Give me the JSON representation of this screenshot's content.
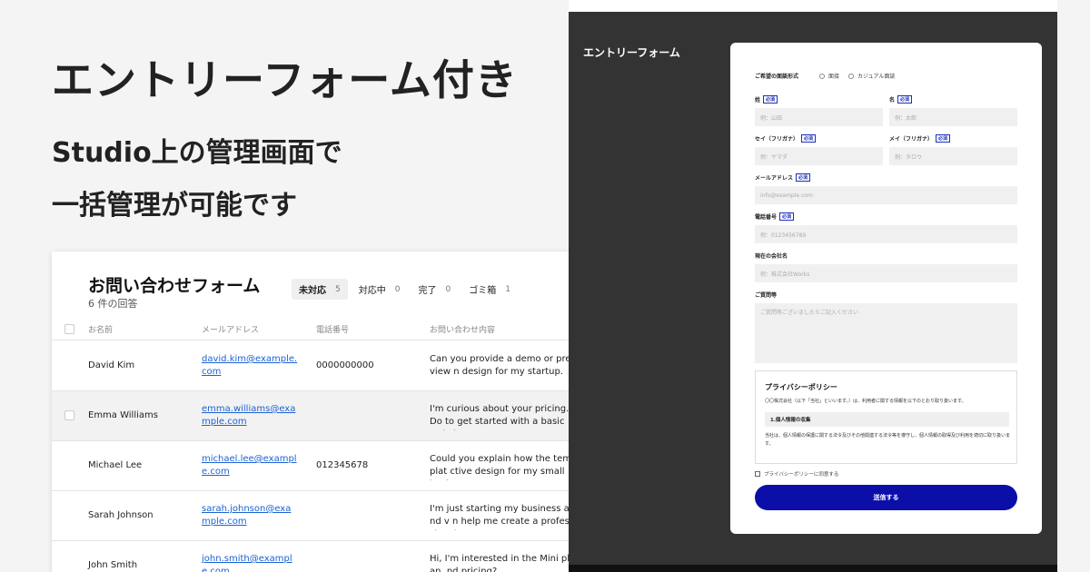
{
  "hero": {
    "title": "エントリーフォーム付き",
    "subtitle_line1": "Studio上の管理画面で",
    "subtitle_line2": "一括管理が可能です"
  },
  "inbox": {
    "title": "お問い合わせフォーム",
    "count": "6 件の回答",
    "filters": [
      {
        "label": "未対応",
        "count": "5",
        "active": true
      },
      {
        "label": "対応中",
        "count": "0",
        "active": false
      },
      {
        "label": "完了",
        "count": "0",
        "active": false
      },
      {
        "label": "ゴミ箱",
        "count": "1",
        "active": false
      }
    ],
    "columns": [
      "お名前",
      "メールアドレス",
      "電話番号",
      "お問い合わせ内容"
    ],
    "rows": [
      {
        "name": "David Kim",
        "email": "david.kim@example.com",
        "phone": "0000000000",
        "message": "Can you provide a demo or preview n design for my startup."
      },
      {
        "name": "Emma Williams",
        "email": "emma.williams@example.com",
        "phone": "",
        "message": "I'm curious about your pricing. Do to get started with a basic website"
      },
      {
        "name": "Michael Lee",
        "email": "michael.lee@example.com",
        "phone": "012345678",
        "message": "Could you explain how the templat ctive design for my small business"
      },
      {
        "name": "Sarah Johnson",
        "email": "sarah.johnson@example.com",
        "phone": "",
        "message": "I'm just starting my business and v n help me create a professional we"
      },
      {
        "name": "John Smith",
        "email": "john.smith@example.com",
        "phone": "",
        "message": "Hi, I'm interested in the Mini plan. nd pricing?"
      }
    ]
  },
  "entry_form": {
    "panel_label": "エントリーフォーム",
    "interview_type_label": "ご希望の面談形式",
    "interview_options": [
      "面接",
      "カジュアル面談"
    ],
    "required_badge": "必須",
    "last_name": {
      "label": "姓",
      "placeholder": "例：山田"
    },
    "first_name": {
      "label": "名",
      "placeholder": "例：太郎"
    },
    "last_name_kana": {
      "label": "セイ（フリガナ）",
      "placeholder": "例：ヤマダ"
    },
    "first_name_kana": {
      "label": "メイ（フリガナ）",
      "placeholder": "例：タロウ"
    },
    "email": {
      "label": "メールアドレス",
      "placeholder": "info@example.com"
    },
    "phone": {
      "label": "電話番号",
      "placeholder": "例：0123456789"
    },
    "company": {
      "label": "現在の会社名",
      "placeholder": "例：株式会社Works"
    },
    "question": {
      "label": "ご質問等",
      "placeholder": "ご質問等ございましたらご記入ください"
    },
    "policy": {
      "title": "プライバシーポリシー",
      "intro": "〇〇株式会社（以下「当社」といいます。）は、利用者に関する情報を以下のとおり取り扱います。",
      "section_title": "1.個人情報の収集",
      "body": "当社は、個人情報の保護に関する法令及びその他関連する法令等を遵守し、個人情報の取得及び利用を適切に取り扱います。"
    },
    "consent_label": "プライバシーポリシーに同意する",
    "submit_label": "送信する"
  }
}
